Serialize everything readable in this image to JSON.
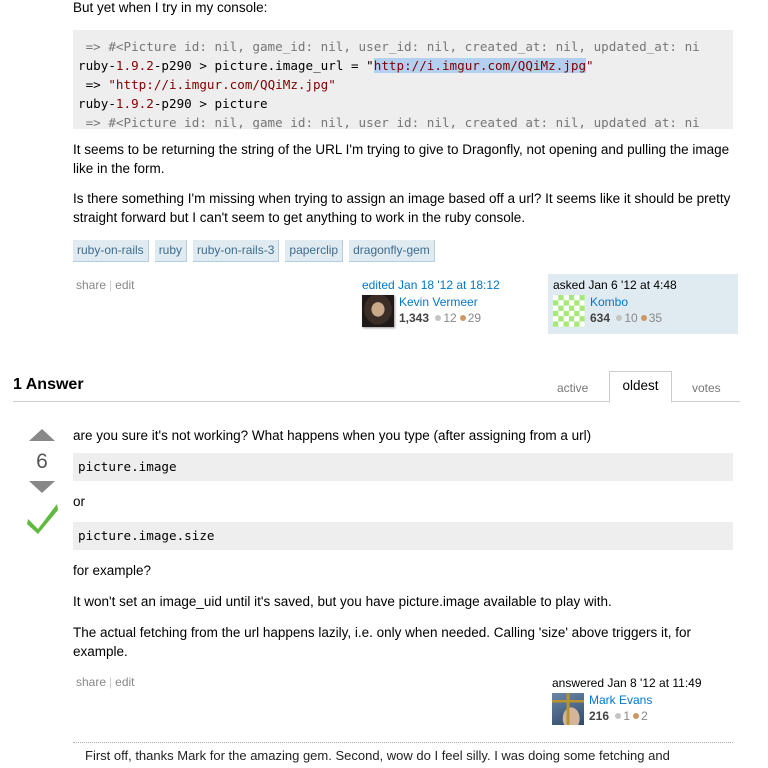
{
  "question": {
    "intro_text": "But yet when I try in my console:",
    "console_lines": [
      {
        "prefix": "",
        "parts": [
          {
            "t": " => #<Picture id: nil, game_id: nil, user_id: nil, created_at: nil, updated_at: ni",
            "c": "gray"
          }
        ]
      },
      {
        "parts": [
          {
            "t": "ruby-",
            "c": "dark"
          },
          {
            "t": "1.9.2",
            "c": "red"
          },
          {
            "t": "-p290 > picture.image_url = \"",
            "c": "dark"
          },
          {
            "t": "http://i.imgur.com/QQiMz.jpg",
            "c": "str-sel"
          },
          {
            "t": "\"",
            "c": "str"
          }
        ]
      },
      {
        "parts": [
          {
            "t": " => ",
            "c": "dark"
          },
          {
            "t": "\"http://i.imgur.com/QQiMz.jpg\"",
            "c": "str"
          }
        ]
      },
      {
        "parts": [
          {
            "t": "ruby-",
            "c": "dark"
          },
          {
            "t": "1.9.2",
            "c": "red"
          },
          {
            "t": "-p290 > picture",
            "c": "dark"
          }
        ]
      },
      {
        "parts": [
          {
            "t": " => #<Picture id: nil, game_id: nil, user_id: nil, created_at: nil, updated_at: ni",
            "c": "gray"
          }
        ]
      }
    ],
    "paragraph_1": "It seems to be returning the string of the URL I'm trying to give to Dragonfly, not opening and pulling the image like in the form.",
    "paragraph_2": "Is there something I'm missing when trying to assign an image based off a url? It seems like it should be pretty straight forward but I can't seem to get anything to work in the ruby console.",
    "tags": [
      "ruby-on-rails",
      "ruby",
      "ruby-on-rails-3",
      "paperclip",
      "dragonfly-gem"
    ],
    "menu": {
      "share": "share",
      "sep": "|",
      "edit": "edit"
    },
    "edited": {
      "action": "edited Jan 18 '12 at 18:12",
      "user": "Kevin Vermeer",
      "rep": "1,343",
      "silver": "12",
      "bronze": "29"
    },
    "asked": {
      "action": "asked Jan 6 '12 at 4:48",
      "user": "Kombo",
      "rep": "634",
      "silver": "10",
      "bronze": "35"
    }
  },
  "answers_header": {
    "title": "1 Answer",
    "tabs": [
      {
        "label": "active",
        "active": false
      },
      {
        "label": "oldest",
        "active": true
      },
      {
        "label": "votes",
        "active": false
      }
    ]
  },
  "answer": {
    "vote_count": "6",
    "accepted": true,
    "intro": "are you sure it's not working? What happens when you type (after assigning from a url)",
    "code_1": "picture.image",
    "or_text": "or",
    "code_2": "picture.image.size",
    "for_example": "for example?",
    "paragraph_1": "It won't set an image_uid until it's saved, but you have picture.image available to play with.",
    "paragraph_2": "The actual fetching from the url happens lazily, i.e. only when needed. Calling 'size' above triggers it, for example.",
    "menu": {
      "share": "share",
      "sep": "|",
      "edit": "edit"
    },
    "answered": {
      "action": "answered Jan 8 '12 at 11:49",
      "user": "Mark Evans",
      "rep": "216",
      "silver": "1",
      "bronze": "2"
    },
    "comment_text": "First off, thanks Mark for the amazing gem. Second, wow do I feel silly. I was doing some fetching and"
  }
}
